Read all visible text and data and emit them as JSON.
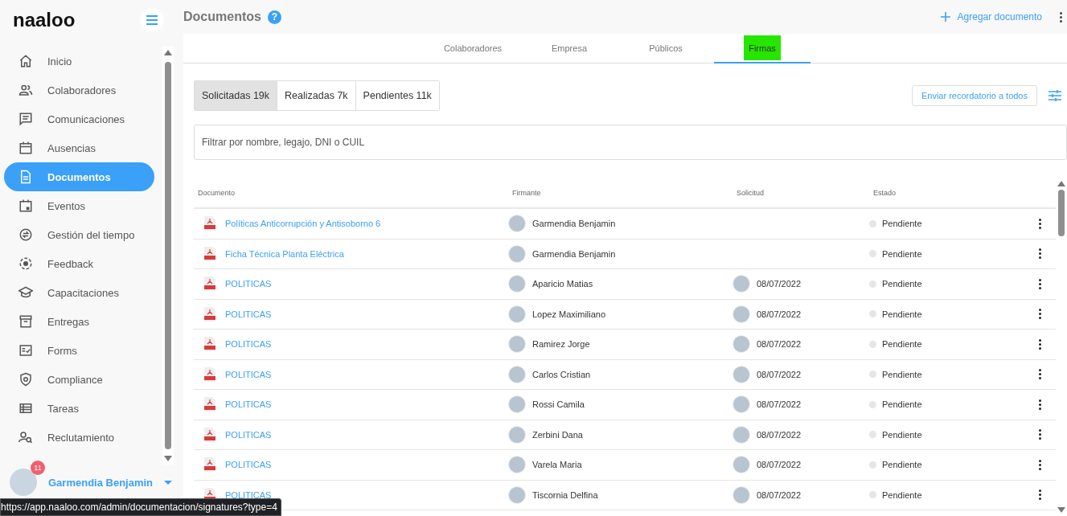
{
  "brand": {
    "logo": "naaloo"
  },
  "sidebar": {
    "items": [
      {
        "label": "Inicio",
        "kind": "home",
        "selected": false
      },
      {
        "label": "Colaboradores",
        "kind": "people",
        "selected": false
      },
      {
        "label": "Comunicaciones",
        "kind": "chat",
        "selected": false
      },
      {
        "label": "Ausencias",
        "kind": "calendar",
        "selected": false
      },
      {
        "label": "Documentos",
        "kind": "document",
        "selected": true
      },
      {
        "label": "Eventos",
        "kind": "event",
        "selected": false
      },
      {
        "label": "Gestión del tiempo",
        "kind": "clock",
        "selected": false
      },
      {
        "label": "Feedback",
        "kind": "feedback",
        "selected": false
      },
      {
        "label": "Capacitaciones",
        "kind": "school",
        "selected": false
      },
      {
        "label": "Entregas",
        "kind": "archive",
        "selected": false
      },
      {
        "label": "Forms",
        "kind": "form",
        "selected": false
      },
      {
        "label": "Compliance",
        "kind": "shield",
        "selected": false
      },
      {
        "label": "Tareas",
        "kind": "list",
        "selected": false
      },
      {
        "label": "Reclutamiento",
        "kind": "search-person",
        "selected": false
      }
    ],
    "user": {
      "name": "Garmendia Benjamin",
      "badge": "11"
    }
  },
  "header": {
    "title": "Documentos",
    "help": "?",
    "action": "Agregar documento"
  },
  "tabs": [
    {
      "label": "Colaboradores",
      "selected": false,
      "highlighted": false
    },
    {
      "label": "Empresa",
      "selected": false,
      "highlighted": false
    },
    {
      "label": "Públicos",
      "selected": false,
      "highlighted": false
    },
    {
      "label": "Firmas",
      "selected": true,
      "highlighted": true
    }
  ],
  "segments": [
    {
      "label": "Solicitadas 19k",
      "selected": true
    },
    {
      "label": "Realizadas 7k",
      "selected": false
    },
    {
      "label": "Pendientes 11k",
      "selected": false
    }
  ],
  "reminder_button": "Enviar recordatorio a todos",
  "search": {
    "placeholder": "Filtrar por nombre, legajo, DNI o CUIL"
  },
  "table": {
    "columns": [
      "Documento",
      "Firmante",
      "Solicitud",
      "Estado"
    ],
    "rows": [
      {
        "document": "Políticas Anticorrupción y Antisoborno 6",
        "signer": "Garmendia Benjamin",
        "requested": null,
        "status": "Pendiente"
      },
      {
        "document": "Ficha Técnica Planta Eléctrica",
        "signer": "Garmendia Benjamin",
        "requested": null,
        "status": "Pendiente"
      },
      {
        "document": "POLITICAS",
        "signer": "Aparicio Matias",
        "requested": "08/07/2022",
        "status": "Pendiente"
      },
      {
        "document": "POLITICAS",
        "signer": "Lopez Maximiliano",
        "requested": "08/07/2022",
        "status": "Pendiente"
      },
      {
        "document": "POLITICAS",
        "signer": "Ramirez Jorge",
        "requested": "08/07/2022",
        "status": "Pendiente"
      },
      {
        "document": "POLITICAS",
        "signer": "Carlos Cristian",
        "requested": "08/07/2022",
        "status": "Pendiente"
      },
      {
        "document": "POLITICAS",
        "signer": "Rossi Camila",
        "requested": "08/07/2022",
        "status": "Pendiente"
      },
      {
        "document": "POLITICAS",
        "signer": "Zerbini Dana",
        "requested": "08/07/2022",
        "status": "Pendiente"
      },
      {
        "document": "POLITICAS",
        "signer": "Varela Maria",
        "requested": "08/07/2022",
        "status": "Pendiente"
      },
      {
        "document": "POLITICAS",
        "signer": "Tiscornia Delfina",
        "requested": "08/07/2022",
        "status": "Pendiente"
      }
    ]
  },
  "status_url": "https://app.naaloo.com/admin/documentacion/signatures?type=4"
}
